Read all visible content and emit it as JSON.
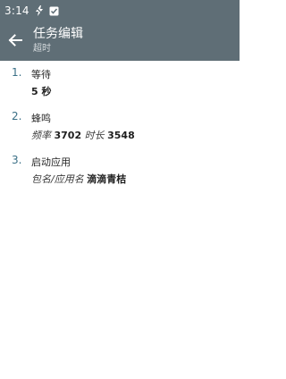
{
  "status_bar": {
    "time": "3:14"
  },
  "app_bar": {
    "title": "任务编辑",
    "subtitle": "超时"
  },
  "steps": [
    {
      "number": "1.",
      "name": "等待",
      "value": "5 秒"
    },
    {
      "number": "2.",
      "name": "蜂鸣",
      "freq_label": "频率",
      "freq_value": "3702",
      "dur_label": "时长",
      "dur_value": "3548"
    },
    {
      "number": "3.",
      "name": "启动应用",
      "pkg_label": "包名/应用名",
      "pkg_value": "滴滴青桔"
    }
  ],
  "colors": {
    "app_bar": "#5f6e76",
    "step_number": "#3a6f86"
  }
}
